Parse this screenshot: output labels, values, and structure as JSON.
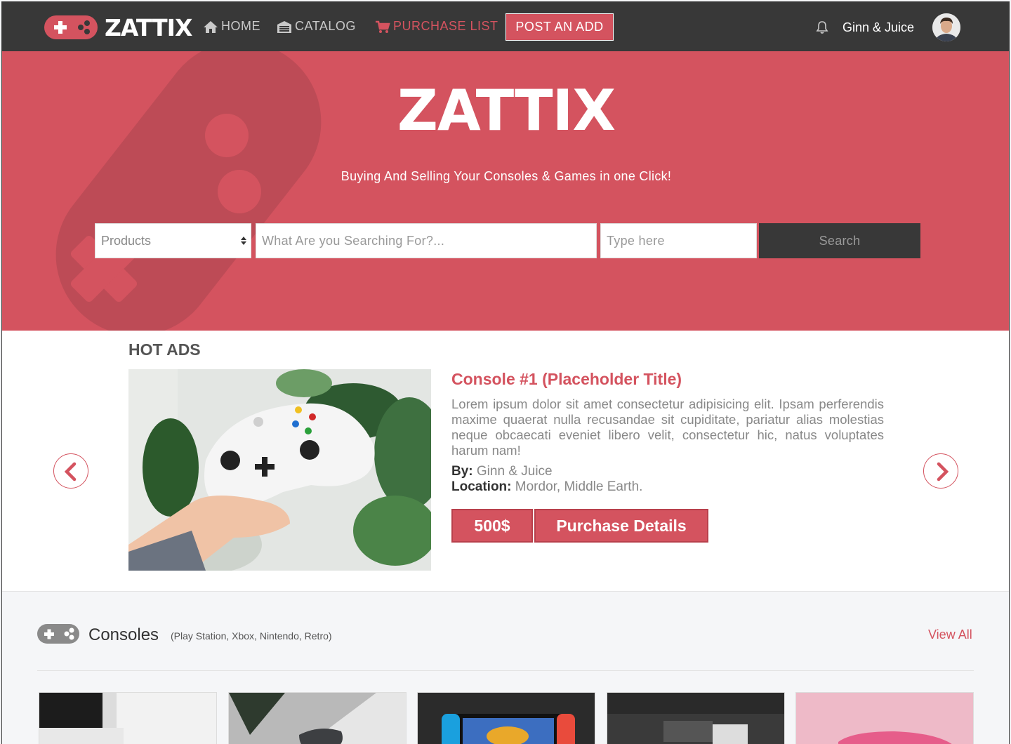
{
  "navbar": {
    "brand": "ZATTIX",
    "items": [
      {
        "label": "HOME",
        "icon": "home-icon"
      },
      {
        "label": "CATALOG",
        "icon": "garage-icon"
      },
      {
        "label": "PURCHASE LIST",
        "icon": "cart-icon"
      }
    ],
    "post_button": "POST AN ADD",
    "username": "Ginn & Juice"
  },
  "hero": {
    "title": "ZATTIX",
    "subtitle": "Buying And Selling Your Consoles & Games in one Click!",
    "select_value": "Products",
    "search_placeholder": "What Are you Searching For?...",
    "type_placeholder": "Type here",
    "search_button": "Search"
  },
  "hot_ads": {
    "heading": "HOT ADS",
    "ad": {
      "title": "Console #1 (Placeholder Title)",
      "description": "Lorem ipsum dolor sit amet consectetur adipisicing elit. Ipsam perferendis maxime quaerat nulla recusandae sit cupiditate, pariatur alias molestias neque obcaecati eveniet libero velit, consectetur hic, natus voluptates harum nam!",
      "by_label": "By:",
      "by_value": "Ginn & Juice",
      "location_label": "Location:",
      "location_value": "Mordor, Middle Earth.",
      "price": "500$",
      "details_button": "Purchase Details"
    }
  },
  "consoles": {
    "title": "Consoles",
    "subtitle": "(Play Station, Xbox, Nintendo, Retro)",
    "view_all": "View All"
  },
  "colors": {
    "accent": "#d4535f",
    "dark": "#383838"
  }
}
